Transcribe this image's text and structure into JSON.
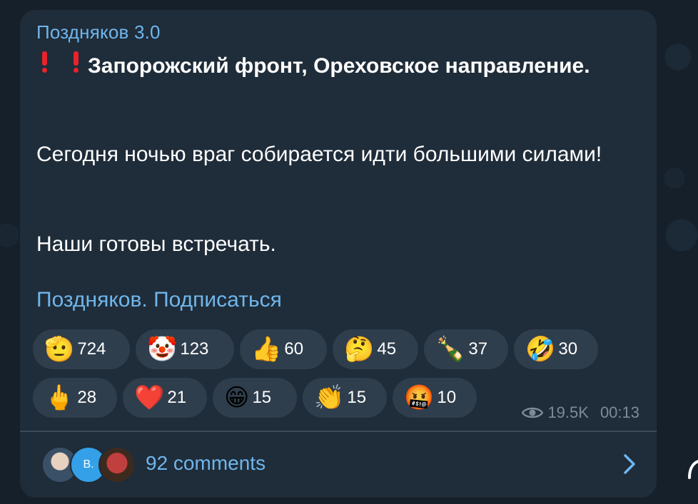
{
  "channel": {
    "name": "Поздняков 3.0"
  },
  "post": {
    "headline": "Запорожский фронт, Ореховское направление.",
    "paragraph1": "Сегодня ночью враг собирается идти большими силами!",
    "paragraph2": "Наши готовы встречать.",
    "link": "Поздняков. Подписаться"
  },
  "reactions": [
    {
      "icon": "saluting-face-emoji",
      "emoji": "🫡",
      "count": "724"
    },
    {
      "icon": "clown-face-emoji",
      "emoji": "🤡",
      "count": "123"
    },
    {
      "icon": "thumbs-up-emoji",
      "emoji": "👍",
      "count": "60"
    },
    {
      "icon": "thinking-face-emoji",
      "emoji": "🤔",
      "count": "45"
    },
    {
      "icon": "champagne-emoji",
      "emoji": "🍾",
      "count": "37"
    },
    {
      "icon": "rolling-laughing-emoji",
      "emoji": "🤣",
      "count": "30"
    },
    {
      "icon": "middle-finger-emoji",
      "emoji": "🖕",
      "count": "28"
    },
    {
      "icon": "red-heart-emoji",
      "emoji": "❤️",
      "count": "21"
    },
    {
      "icon": "grinning-face-emoji",
      "emoji": "😁",
      "count": "15"
    },
    {
      "icon": "clapping-hands-emoji",
      "emoji": "👏",
      "count": "15"
    },
    {
      "icon": "cursing-face-emoji",
      "emoji": "🤬",
      "count": "10"
    }
  ],
  "meta": {
    "views": "19.5K",
    "time": "00:13"
  },
  "comments": {
    "label": "92 comments",
    "avatar_initial": "В."
  },
  "colors": {
    "accent": "#6fb6ec",
    "bubble": "#1f2c39",
    "background": "#15202b",
    "reaction_bg": "#2f3e4d",
    "meta": "#7d8b99"
  }
}
